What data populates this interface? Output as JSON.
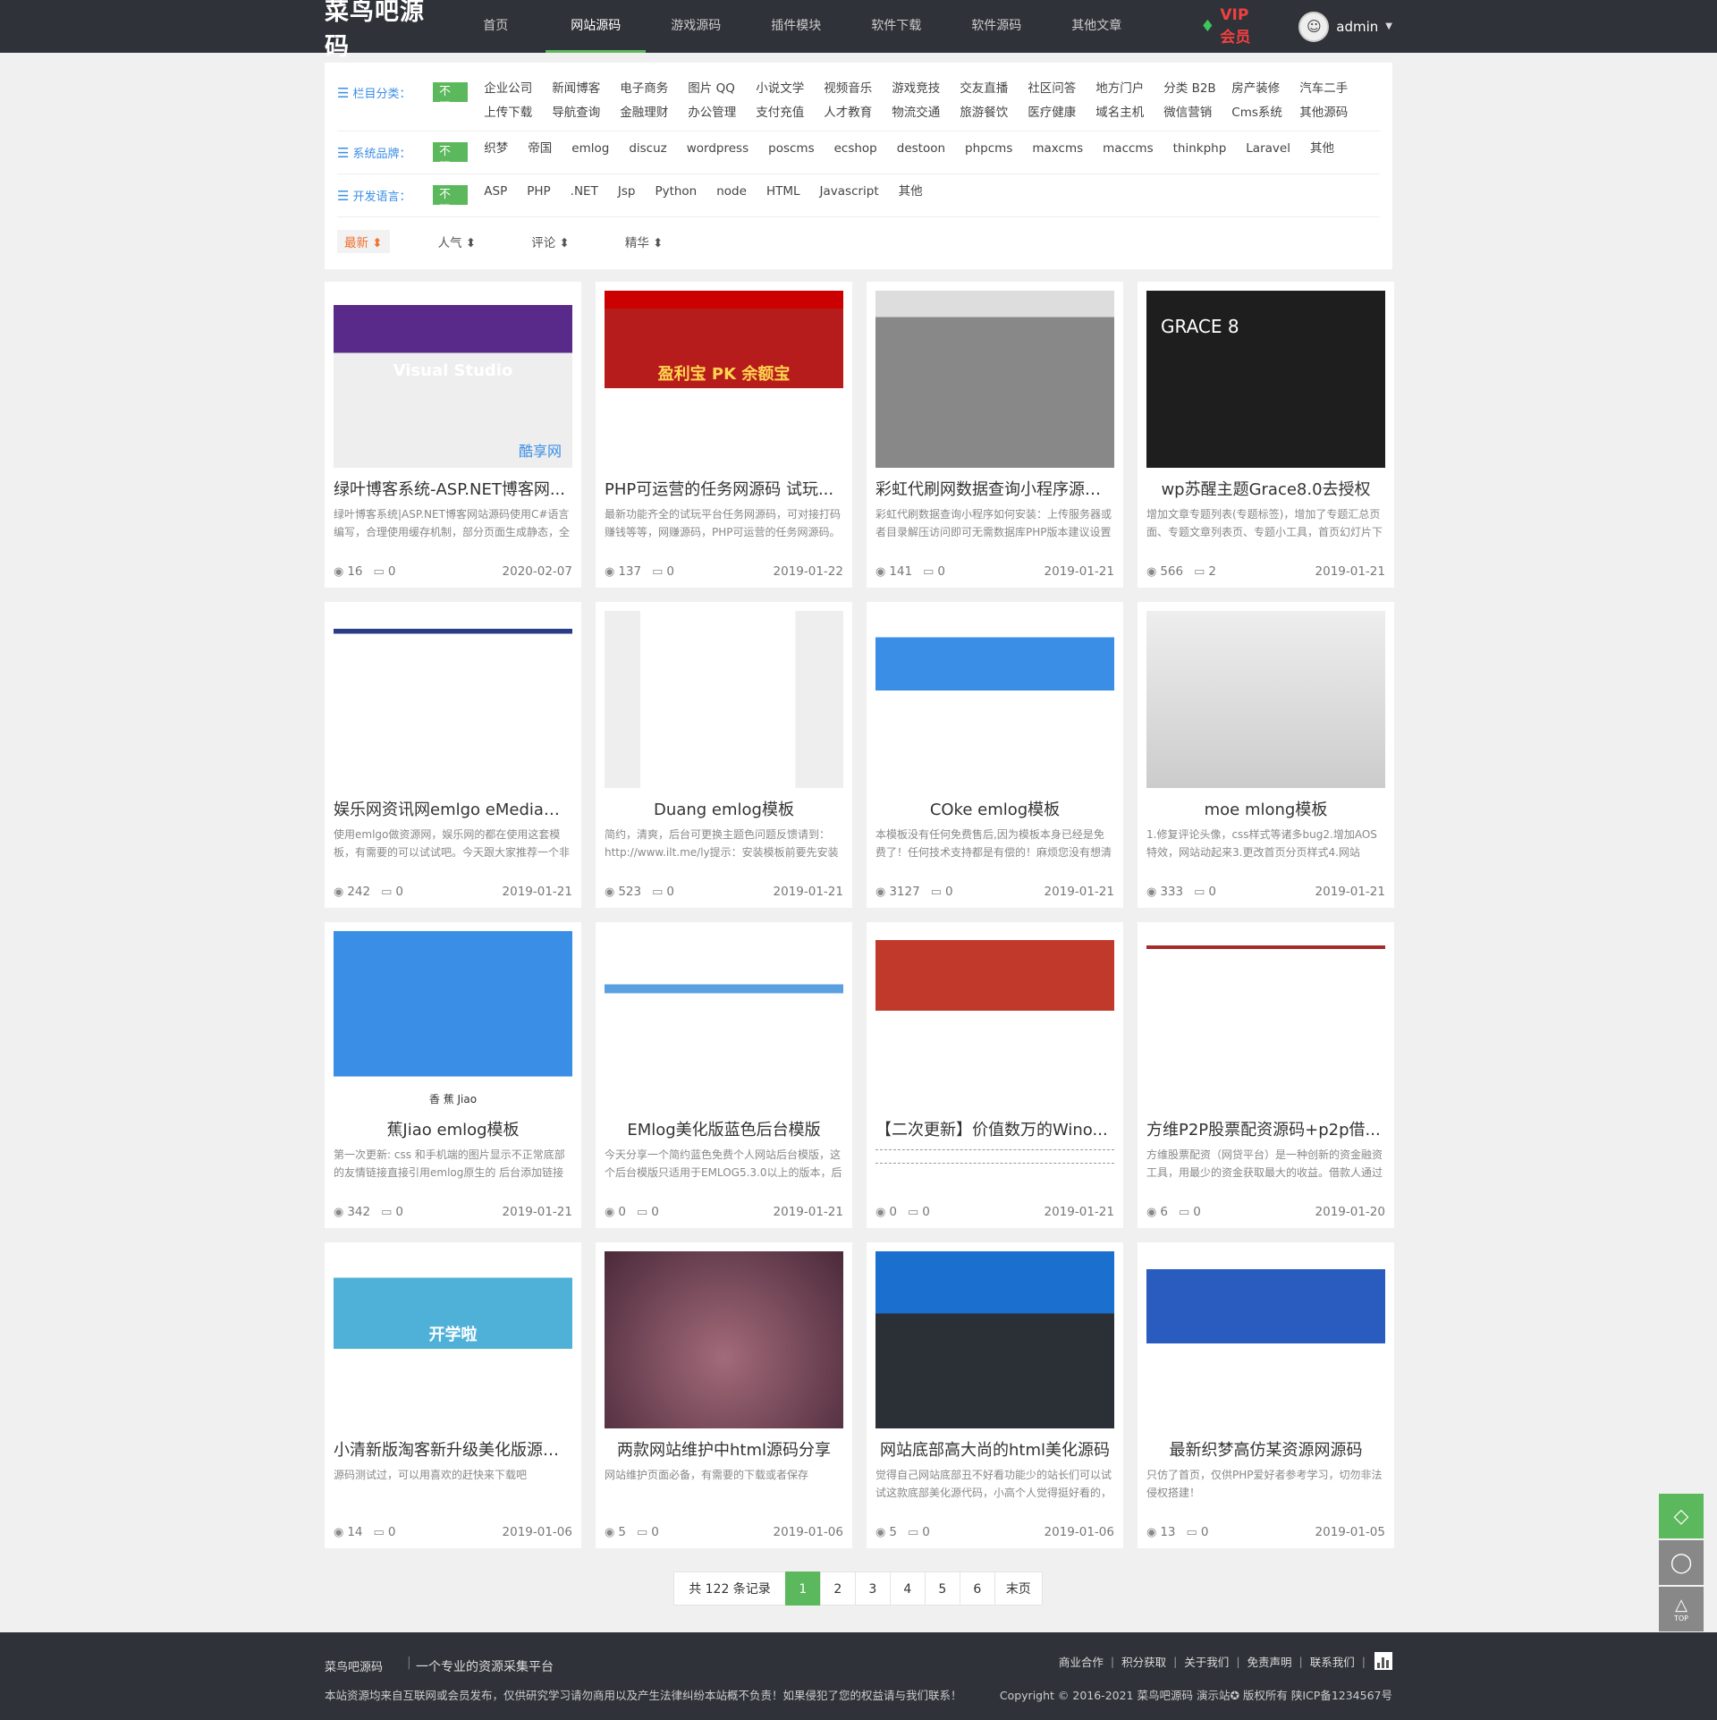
{
  "header": {
    "logo": "菜鸟吧源码",
    "nav": [
      "首页",
      "网站源码",
      "游戏源码",
      "插件模块",
      "软件下载",
      "软件源码",
      "其他文章"
    ],
    "vip": "VIP会员",
    "user": "admin"
  },
  "filter": {
    "category_label": "栏目分类：",
    "brand_label": "系统品牌：",
    "lang_label": "开发语言：",
    "all": "不限",
    "categories": [
      "企业公司",
      "新闻博客",
      "电子商务",
      "图片 QQ",
      "小说文学",
      "视频音乐",
      "游戏竞技",
      "交友直播",
      "社区问答",
      "地方门户",
      "分类 B2B",
      "房产装修",
      "汽车二手",
      "上传下载",
      "导航查询",
      "金融理财",
      "办公管理",
      "支付充值",
      "人才教育",
      "物流交通",
      "旅游餐饮",
      "医疗健康",
      "域名主机",
      "微信营销",
      "Cms系统",
      "其他源码"
    ],
    "brands": [
      "织梦",
      "帝国",
      "emlog",
      "discuz",
      "wordpress",
      "poscms",
      "ecshop",
      "destoon",
      "phpcms",
      "maxcms",
      "maccms",
      "thinkphp",
      "Laravel",
      "其他"
    ],
    "languages": [
      "ASP",
      "PHP",
      ".NET",
      "Jsp",
      "Python",
      "node",
      "HTML",
      "Javascript",
      "其他"
    ],
    "sorts": [
      "最新 ⬍",
      "人气 ⬍",
      "评论 ⬍",
      "精华 ⬍"
    ]
  },
  "cards": [
    {
      "title": "绿叶博客系统-ASP.NET博客网...",
      "desc": "绿叶博客系统|ASP.NET博客网站源码使用C#语言编写，合理使用缓存机制，部分页面生成静态，全",
      "views": "16",
      "comments": "0",
      "date": "2020-02-07",
      "thumb_text": "Visual Studio",
      "watermark": "酷享网"
    },
    {
      "title": "PHP可运营的任务网源码 试玩...",
      "desc": "最新功能齐全的试玩平台任务网源码，可对接打码赚钱等等，网赚源码，PHP可运营的任务网源码。",
      "views": "137",
      "comments": "0",
      "date": "2019-01-22",
      "thumb_text": "盈利宝 PK 余额宝"
    },
    {
      "title": "彩虹代刷网数据查询小程序源码...",
      "desc": "彩虹代刷数据查询小程序如何安装：上传服务器或者目录解压访问即可无需数据库PHP版本建议设置",
      "views": "141",
      "comments": "0",
      "date": "2019-01-21"
    },
    {
      "title": "wp苏醒主题Grace8.0去授权",
      "desc": "增加文章专题列表(专题标签)，增加了专题汇总页面、专题文章列表页、专题小工具，首页幻灯片下",
      "views": "566",
      "comments": "2",
      "date": "2019-01-21",
      "thumb_text": "GRACE 8"
    },
    {
      "title": "娱乐网资讯网emlgo eMedia媒...",
      "desc": "使用emlgo做资源网，娱乐网的都在使用这套模板，有需要的可以试试吧。今天跟大家推荐一个非",
      "views": "242",
      "comments": "0",
      "date": "2019-01-21"
    },
    {
      "title": "Duang emlog模板",
      "desc": "简约，清爽，后台可更换主题色问题反馈请到：http://www.ilt.me/ly提示：安装模板前要先安装",
      "views": "523",
      "comments": "0",
      "date": "2019-01-21"
    },
    {
      "title": "COke emlog模板",
      "desc": "本模板没有任何免费售后,因为模板本身已经是免费了！任何技术支持都是有偿的！麻烦您没有想清楚",
      "views": "3127",
      "comments": "0",
      "date": "2019-01-21"
    },
    {
      "title": "moe mlong模板",
      "desc": "1.修复评论头像，css样式等诸多bug2.增加AOS特效，网站动起来3.更改首页分页样式4.网站header",
      "views": "333",
      "comments": "0",
      "date": "2019-01-21"
    },
    {
      "title": "蕉Jiao emlog模板",
      "desc": "第一次更新: css 和手机端的图片显示不正常底部的友情链接直接引用emlog原生的 后台添加链接便",
      "views": "342",
      "comments": "0",
      "date": "2019-01-21",
      "thumb_text": "香 蕉 Jiao"
    },
    {
      "title": "EMlog美化版蓝色后台模版",
      "desc": "今天分享一个简约蓝色免费个人网站后台模版，这个后台模版只适用于EMLOG5.3.0以上的版本，后",
      "views": "0",
      "comments": "0",
      "date": "2019-01-21"
    },
    {
      "title": "【二次更新】价值数万的Wino...",
      "desc": "",
      "views": "0",
      "comments": "0",
      "date": "2019-01-21"
    },
    {
      "title": "方维P2P股票配资源码+p2p借...",
      "desc": "方维股票配资（网贷平台）是一种创新的资金融资工具，用最少的资金获取最大的收益。借款人通过",
      "views": "6",
      "comments": "0",
      "date": "2019-01-20"
    },
    {
      "title": "小清新版淘客新升级美化版源码...",
      "desc": "源码测试过，可以用喜欢的赶快来下载吧",
      "views": "14",
      "comments": "0",
      "date": "2019-01-06",
      "thumb_text": "开学啦"
    },
    {
      "title": "两款网站维护中html源码分享",
      "desc": "网站维护页面必备，有需要的下载或者保存",
      "views": "5",
      "comments": "0",
      "date": "2019-01-06"
    },
    {
      "title": "网站底部高大尚的html美化源码",
      "desc": "觉得自己网站底部丑不好看功能少的站长们可以试试这款底部美化源代码，小高个人觉得挺好看的，",
      "views": "5",
      "comments": "0",
      "date": "2019-01-06"
    },
    {
      "title": "最新织梦高仿某资源网源码",
      "desc": "只仿了首页，仅供PHP爱好者参考学习，切勿非法侵权搭建！",
      "views": "13",
      "comments": "0",
      "date": "2019-01-05"
    }
  ],
  "pager": {
    "total": "共 122 条记录",
    "pages": [
      "1",
      "2",
      "3",
      "4",
      "5",
      "6"
    ],
    "last": "末页"
  },
  "footer": {
    "site": "菜鸟吧源码",
    "slogan": "一个专业的资源采集平台",
    "notice": "本站资源均来自互联网或会员发布，仅供研究学习请勿商用以及产生法律纠纷本站概不负责！如果侵犯了您的权益请与我们联系！",
    "links": [
      "商业合作",
      "积分获取",
      "关于我们",
      "免责声明",
      "联系我们"
    ],
    "copyright": "Copyright © 2016-2021 菜鸟吧源码 演示站✪ 版权所有 陕ICP备1234567号"
  },
  "side": {
    "top": "TOP"
  },
  "colors": {
    "accent": "#5cb85c",
    "header": "#2f3238",
    "label": "#3a8ee6",
    "vip": "#f04040"
  }
}
